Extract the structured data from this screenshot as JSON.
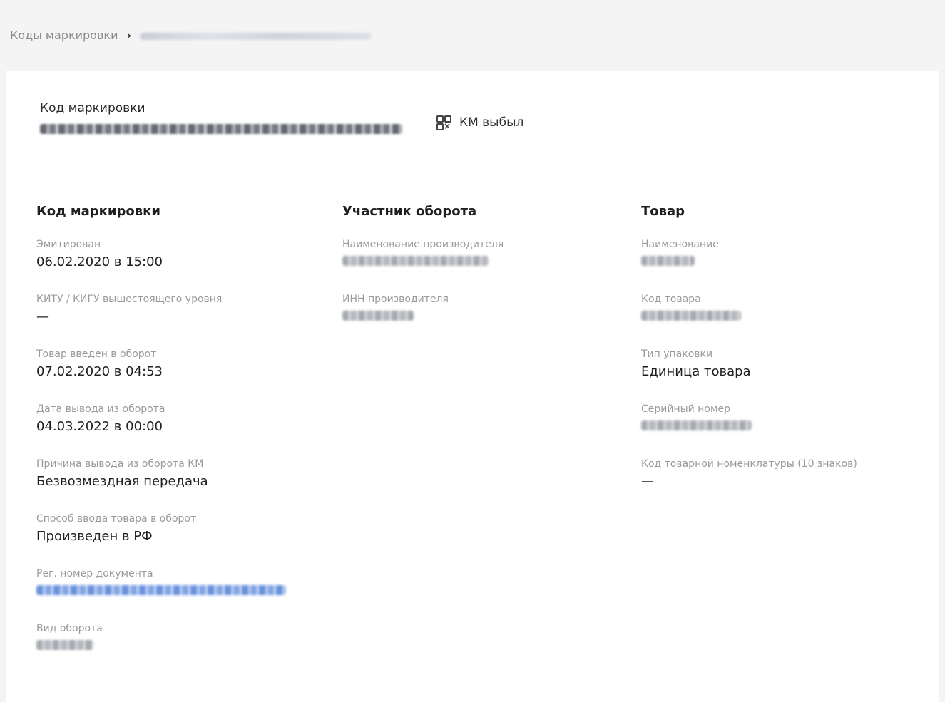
{
  "breadcrumb": {
    "root": "Коды маркировки",
    "separator": "›"
  },
  "header": {
    "label": "Код маркировки",
    "status_icon": "qr-code-x-icon",
    "status": "КМ выбыл"
  },
  "columns": {
    "code": {
      "title": "Код маркировки",
      "fields": [
        {
          "label": "Эмитирован",
          "value": "06.02.2020 в 15:00"
        },
        {
          "label": "КИТУ / КИГУ вышестоящего уровня",
          "value": "—"
        },
        {
          "label": "Товар введен в оборот",
          "value": "07.02.2020 в 04:53"
        },
        {
          "label": "Дата вывода из оборота",
          "value": "04.03.2022 в 00:00"
        },
        {
          "label": "Причина вывода из оборота КМ",
          "value": "Безвозмездная передача"
        },
        {
          "label": "Способ ввода товара в оборот",
          "value": "Произведен в РФ"
        },
        {
          "label": "Рег. номер документа",
          "value": ""
        },
        {
          "label": "Вид оборота",
          "value": ""
        }
      ]
    },
    "participant": {
      "title": "Участник оборота",
      "fields": [
        {
          "label": "Наименование производителя",
          "value": ""
        },
        {
          "label": "ИНН производителя",
          "value": ""
        }
      ]
    },
    "product": {
      "title": "Товар",
      "fields": [
        {
          "label": "Наименование",
          "value": ""
        },
        {
          "label": "Код товара",
          "value": ""
        },
        {
          "label": "Тип упаковки",
          "value": "Единица товара"
        },
        {
          "label": "Серийный номер",
          "value": ""
        },
        {
          "label": "Код товарной номенклатуры (10 знаков)",
          "value": "—"
        }
      ]
    }
  },
  "colors": {
    "link": "#3d6fd6",
    "label": "#9a9a9a",
    "text": "#1f1f1f",
    "background": "#f3f3f3",
    "card": "#ffffff"
  }
}
